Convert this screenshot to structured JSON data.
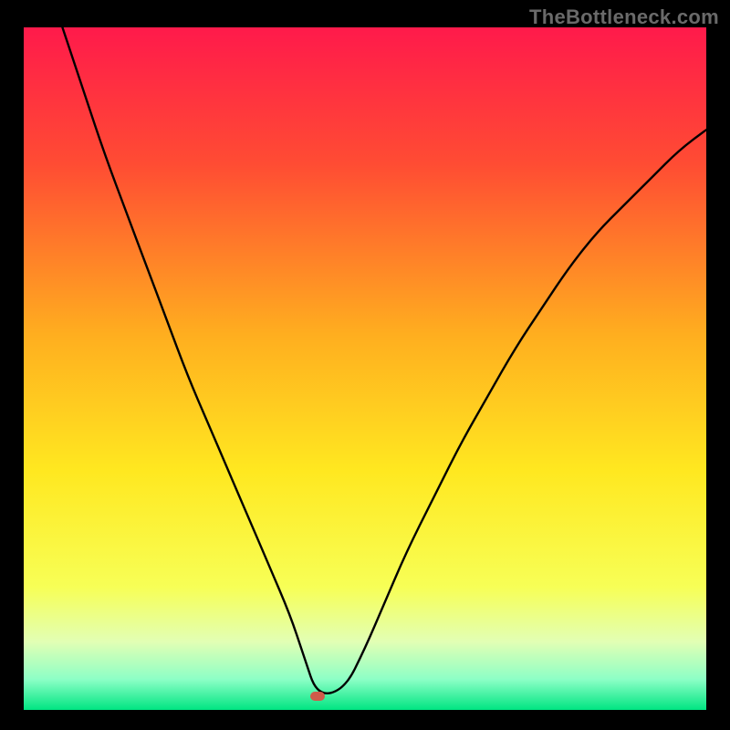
{
  "watermark": "TheBottleneck.com",
  "colors": {
    "frame": "#000000",
    "watermark": "#6a6a6a",
    "curve": "#000000",
    "marker": "#cf5b4a",
    "gradient_stops": [
      {
        "offset": 0.0,
        "color": "#ff1a4b"
      },
      {
        "offset": 0.2,
        "color": "#ff4c33"
      },
      {
        "offset": 0.45,
        "color": "#ffae1f"
      },
      {
        "offset": 0.65,
        "color": "#ffe820"
      },
      {
        "offset": 0.82,
        "color": "#f7ff56"
      },
      {
        "offset": 0.9,
        "color": "#e2ffb4"
      },
      {
        "offset": 0.955,
        "color": "#8dffc6"
      },
      {
        "offset": 1.0,
        "color": "#00e582"
      }
    ]
  },
  "chart_data": {
    "type": "line",
    "title": "",
    "xlabel": "",
    "ylabel": "",
    "xlim": [
      0,
      100
    ],
    "ylim": [
      0,
      100
    ],
    "grid": false,
    "legend": false,
    "series": [
      {
        "name": "bottleneck-curve",
        "x": [
          0,
          3,
          6,
          9,
          12,
          15,
          18,
          21,
          24,
          27,
          30,
          33,
          36,
          39,
          41,
          43,
          47,
          50,
          53,
          56,
          60,
          64,
          68,
          72,
          76,
          80,
          84,
          88,
          92,
          96,
          100
        ],
        "values": [
          117,
          108,
          99,
          90,
          81,
          73,
          65,
          57,
          49,
          42,
          35,
          28,
          21,
          14,
          8,
          2,
          3,
          9,
          16,
          23,
          31,
          39,
          46,
          53,
          59,
          65,
          70,
          74,
          78,
          82,
          85
        ]
      }
    ],
    "marker": {
      "x": 43,
      "y": 2
    },
    "background": "vertical-gradient"
  }
}
